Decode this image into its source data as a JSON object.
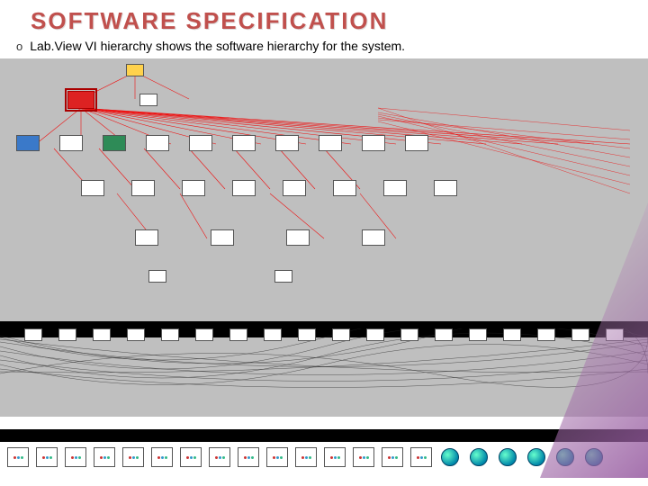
{
  "title": "SOFTWARE SPECIFICATION",
  "bullet": {
    "marker": "o",
    "text": "Lab.View VI hierarchy shows the software hierarchy for the system."
  }
}
